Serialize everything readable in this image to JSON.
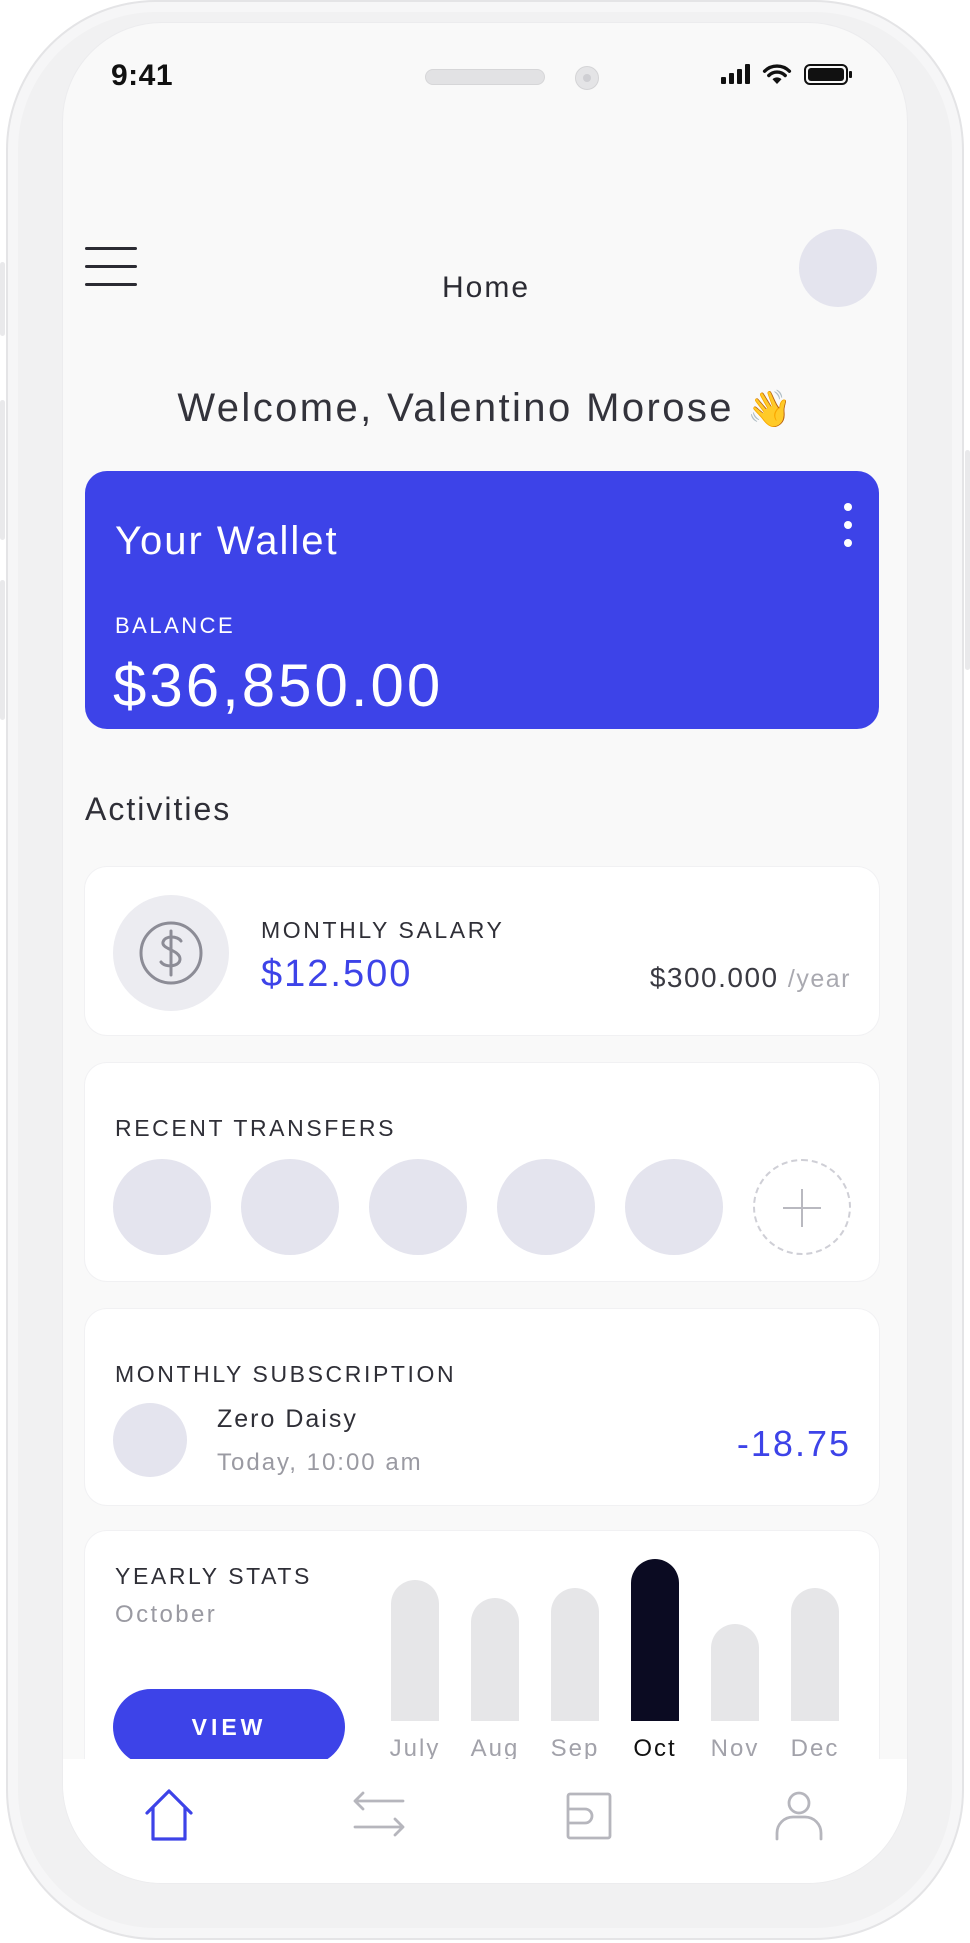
{
  "status_bar": {
    "time": "9:41"
  },
  "header": {
    "title": "Home"
  },
  "welcome": {
    "text": "Welcome, Valentino Morose",
    "emoji": "👋"
  },
  "wallet": {
    "title": "Your Wallet",
    "balance_label": "BALANCE",
    "balance": "$36,850.00"
  },
  "activities": {
    "title": "Activities"
  },
  "salary": {
    "label": "MONTHLY SALARY",
    "monthly": "$12.500",
    "yearly": "$300.000",
    "yearly_unit": "/year"
  },
  "transfers": {
    "label": "RECENT TRANSFERS"
  },
  "subscription": {
    "label": "MONTHLY SUBSCRIPTION",
    "name": "Zero Daisy",
    "time": "Today, 10:00 am",
    "amount": "-18.75"
  },
  "stats": {
    "label": "YEARLY STATS",
    "selected_month": "October",
    "button": "VIEW",
    "months": [
      "July",
      "Aug",
      "Sep",
      "Oct",
      "Nov",
      "Dec"
    ],
    "levels": [
      0.87,
      0.76,
      0.82,
      1.0,
      0.6,
      0.82
    ],
    "active_index": 3
  },
  "tabs": [
    "home-icon",
    "transfer-icon",
    "wallet-icon",
    "profile-icon"
  ],
  "colors": {
    "accent": "#3d43e8",
    "bar": "#e6e6e8",
    "bar_active": "#0b0b22",
    "avatar": "#e4e4ee"
  }
}
